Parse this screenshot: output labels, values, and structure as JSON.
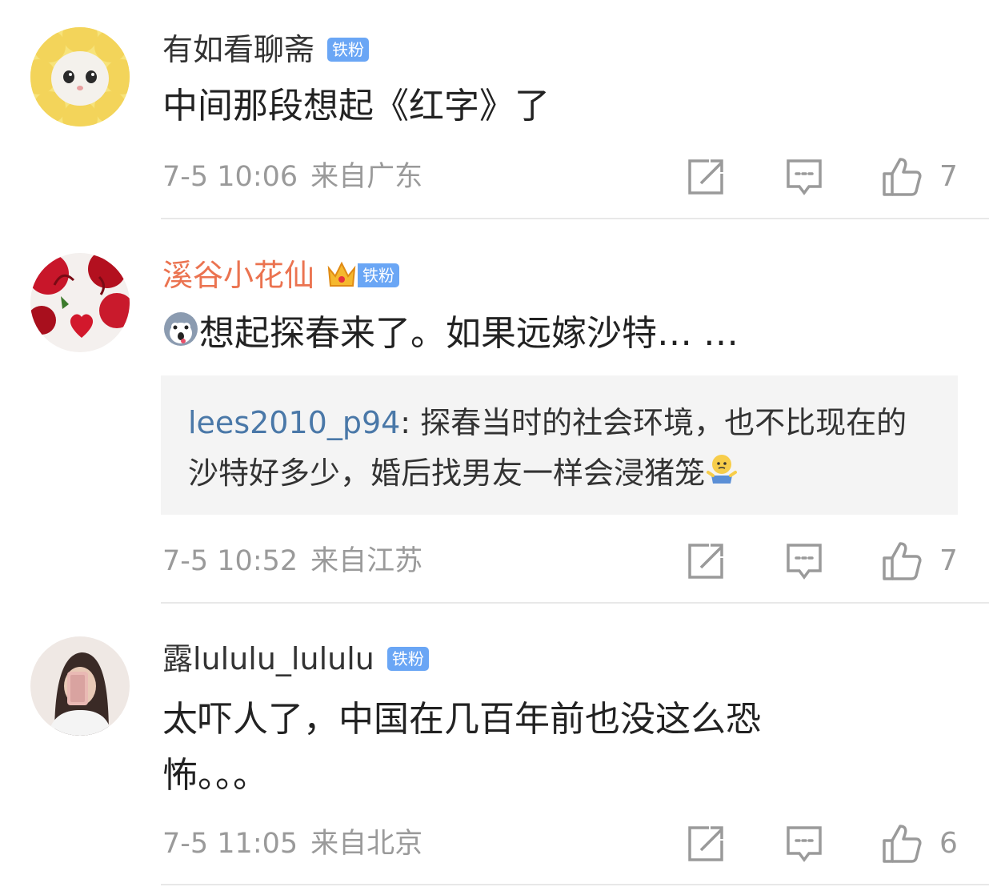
{
  "comments": [
    {
      "username": "有如看聊斋",
      "badge": "铁粉",
      "text": "中间那段想起《红字》了",
      "time": "7-5 10:06",
      "location": "来自广东",
      "likes": "7"
    },
    {
      "username": "溪谷小花仙",
      "badge": "铁粉",
      "text": "想起探春来了。如果远嫁沙特… …",
      "reply_user": "lees2010_p94",
      "reply_text": ": 探春当时的社会环境，也不比现在的沙特好多少，婚后找男友一样会浸猪笼",
      "time": "7-5 10:52",
      "location": "来自江苏",
      "likes": "7"
    },
    {
      "username": "露lululu_lululu",
      "badge": "铁粉",
      "text_line1": "太吓人了，中国在几百年前也没这么恐",
      "text_line2": "怖。。。",
      "time": "7-5 11:05",
      "location": "来自北京",
      "likes": "6"
    }
  ],
  "icons": {
    "forward": "forward-icon",
    "comment": "comment-icon",
    "like": "thumbs-up-icon"
  },
  "colors": {
    "vip_name": "#eb7350",
    "badge_bg": "#6aa6f5",
    "reply_user": "#4a78a8",
    "meta": "#9a9a9a"
  }
}
